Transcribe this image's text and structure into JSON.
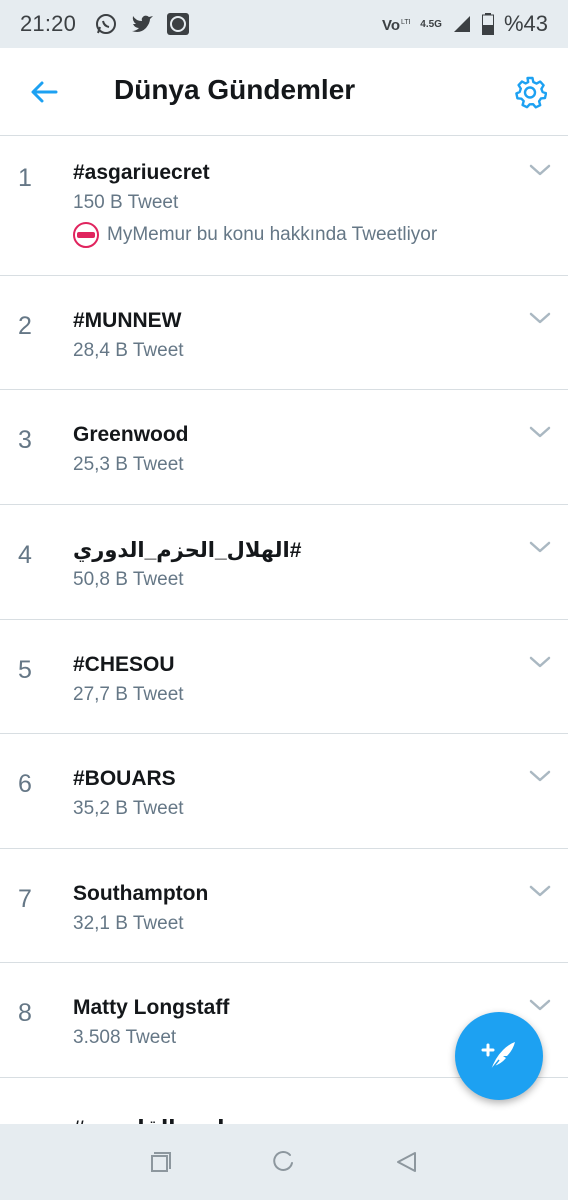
{
  "status_bar": {
    "time": "21:20",
    "network": "4.5G",
    "battery": "%43",
    "icons": [
      "whatsapp-icon",
      "twitter-icon",
      "app-icon",
      "volte-icon",
      "signal-icon",
      "battery-icon"
    ]
  },
  "header": {
    "title": "Dünya Gündemler",
    "back_icon": "arrow-left-icon",
    "settings_icon": "gear-icon"
  },
  "trends": [
    {
      "rank": "1",
      "name": "#asgariuecret",
      "count": "150 B Tweet",
      "promo": "MyMemur bu konu hakkında Tweetliyor"
    },
    {
      "rank": "2",
      "name": "#MUNNEW",
      "count": "28,4 B Tweet"
    },
    {
      "rank": "3",
      "name": "Greenwood",
      "count": "25,3 B Tweet"
    },
    {
      "rank": "4",
      "name": "#الهلال_الحزم_الدوري",
      "count": "50,8 B Tweet"
    },
    {
      "rank": "5",
      "name": "#CHESOU",
      "count": "27,7 B Tweet"
    },
    {
      "rank": "6",
      "name": "#BOUARS",
      "count": "35,2 B Tweet"
    },
    {
      "rank": "7",
      "name": "Southampton",
      "count": "32,1 B Tweet"
    },
    {
      "rank": "8",
      "name": "Matty Longstaff",
      "count": "3.508 Tweet"
    }
  ],
  "partial_trend": {
    "name": "#نادي_القادسية Harvey Baby"
  },
  "colors": {
    "accent": "#1da1f2",
    "text_primary": "#14171a",
    "text_secondary": "#657786",
    "divider": "#d8dee2",
    "system_bar": "#e6ecf0"
  },
  "fab": {
    "icon": "compose-tweet-icon"
  },
  "nav_bar": {
    "icons": [
      "recents-icon",
      "home-icon",
      "back-icon"
    ]
  }
}
